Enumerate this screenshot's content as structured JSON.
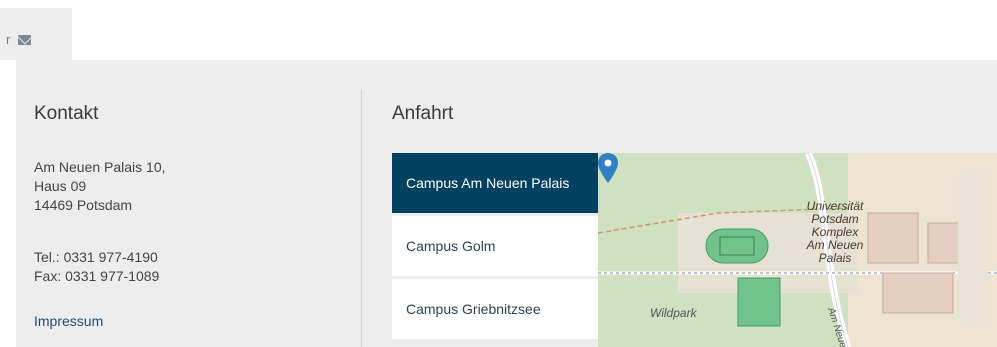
{
  "tab": {
    "partial_text": "r"
  },
  "kontakt": {
    "heading": "Kontakt",
    "address": [
      "Am Neuen Palais 10,",
      "Haus 09",
      "14469 Potsdam"
    ],
    "tel": "Tel.: 0331 977-4190",
    "fax": "Fax: 0331 977-1089",
    "impressum": "Impressum"
  },
  "anfahrt": {
    "heading": "Anfahrt",
    "campuses": [
      {
        "label": "Campus Am Neuen Palais",
        "active": true
      },
      {
        "label": "Campus Golm",
        "active": false
      },
      {
        "label": "Campus Griebnitzsee",
        "active": false
      }
    ],
    "map": {
      "poi_label": [
        "Universität",
        "Potsdam",
        "Komplex",
        "Am Neuen",
        "Palais"
      ],
      "area_label": "Wildpark",
      "street_label": "Am Neuen",
      "colors": {
        "forest": "#cfe1c1",
        "sports": "#6fc38b",
        "road": "#ffffff",
        "pin": "#2f7fc4"
      }
    }
  }
}
